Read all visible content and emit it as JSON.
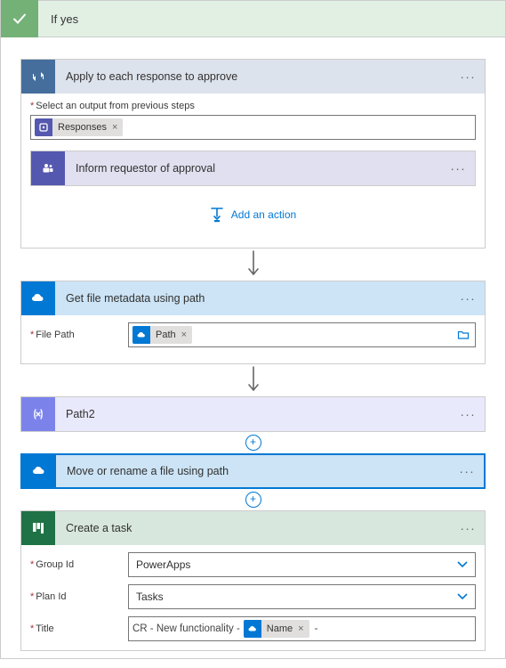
{
  "condition": {
    "label": "If yes"
  },
  "apply_each": {
    "title": "Apply to each response to approve",
    "output_label": "Select an output from previous steps",
    "token": {
      "label": "Responses"
    },
    "inner_action": {
      "title": "Inform requestor of approval"
    },
    "add_action": "Add an action"
  },
  "get_file": {
    "title": "Get file metadata using path",
    "file_path_label": "File Path",
    "token": {
      "label": "Path"
    }
  },
  "path2": {
    "title": "Path2"
  },
  "move": {
    "title": "Move or rename a file using path"
  },
  "task": {
    "title": "Create a task",
    "group_label": "Group Id",
    "group_value": "PowerApps",
    "plan_label": "Plan Id",
    "plan_value": "Tasks",
    "title_label": "Title",
    "title_prefix": "CR - New  functionality -",
    "title_token": "Name",
    "title_suffix": "-"
  }
}
